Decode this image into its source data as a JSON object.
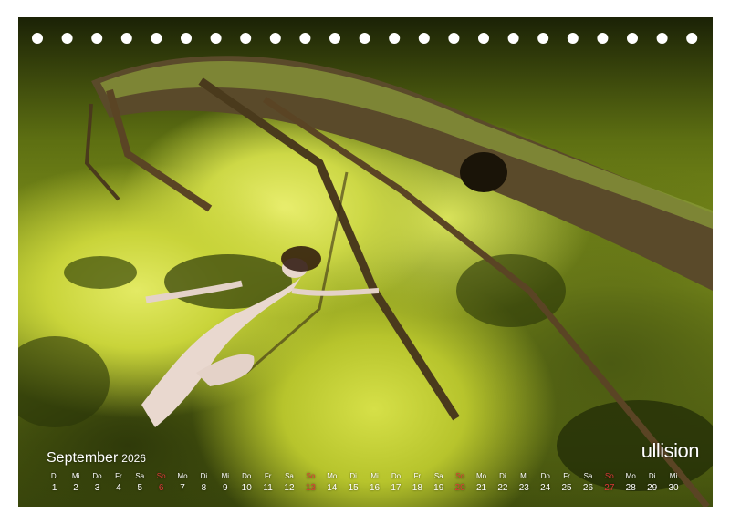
{
  "brand": {
    "text": "ullision"
  },
  "calendar": {
    "month": "September",
    "year": "2026",
    "days": [
      {
        "wd": "Di",
        "dn": "1"
      },
      {
        "wd": "Mi",
        "dn": "2"
      },
      {
        "wd": "Do",
        "dn": "3"
      },
      {
        "wd": "Fr",
        "dn": "4"
      },
      {
        "wd": "Sa",
        "dn": "5"
      },
      {
        "wd": "So",
        "dn": "6",
        "sun": true
      },
      {
        "wd": "Mo",
        "dn": "7"
      },
      {
        "wd": "Di",
        "dn": "8"
      },
      {
        "wd": "Mi",
        "dn": "9"
      },
      {
        "wd": "Do",
        "dn": "10"
      },
      {
        "wd": "Fr",
        "dn": "11"
      },
      {
        "wd": "Sa",
        "dn": "12"
      },
      {
        "wd": "So",
        "dn": "13",
        "sun": true
      },
      {
        "wd": "Mo",
        "dn": "14"
      },
      {
        "wd": "Di",
        "dn": "15"
      },
      {
        "wd": "Mi",
        "dn": "16"
      },
      {
        "wd": "Do",
        "dn": "17"
      },
      {
        "wd": "Fr",
        "dn": "18"
      },
      {
        "wd": "Sa",
        "dn": "19"
      },
      {
        "wd": "So",
        "dn": "20",
        "sun": true
      },
      {
        "wd": "Mo",
        "dn": "21"
      },
      {
        "wd": "Di",
        "dn": "22"
      },
      {
        "wd": "Mi",
        "dn": "23"
      },
      {
        "wd": "Do",
        "dn": "24"
      },
      {
        "wd": "Fr",
        "dn": "25"
      },
      {
        "wd": "Sa",
        "dn": "26"
      },
      {
        "wd": "So",
        "dn": "27",
        "sun": true
      },
      {
        "wd": "Mo",
        "dn": "28"
      },
      {
        "wd": "Di",
        "dn": "29"
      },
      {
        "wd": "Mi",
        "dn": "30"
      }
    ]
  },
  "colors": {
    "sunday": "#e0383a",
    "text": "#ffffff",
    "moss": "#c9d43a"
  }
}
